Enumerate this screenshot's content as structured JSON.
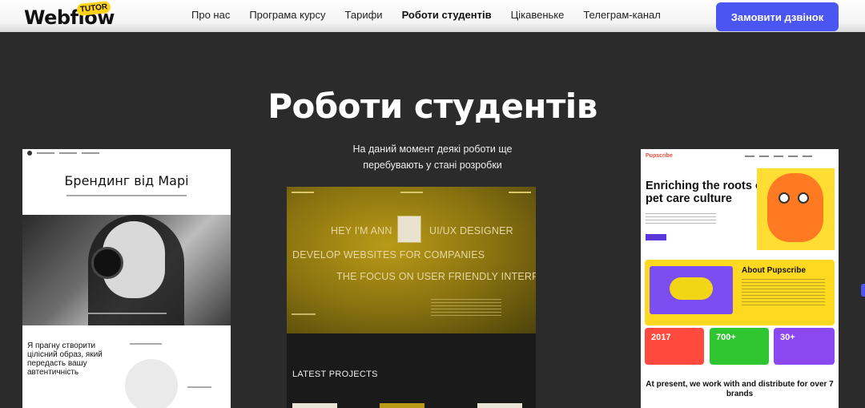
{
  "header": {
    "logo_text": "Webflow",
    "logo_badge": "TUTOR",
    "nav": [
      {
        "label": "Про нас",
        "active": false
      },
      {
        "label": "Програма курсу",
        "active": false
      },
      {
        "label": "Тарифи",
        "active": false
      },
      {
        "label": "Роботи студентів",
        "active": true
      },
      {
        "label": "Цікавеньке",
        "active": false
      },
      {
        "label": "Телеграм-канал",
        "active": false
      }
    ],
    "cta_label": "Замовити дзвінок",
    "cta_color": "#4a55f2"
  },
  "section": {
    "title": "Роботи студентів",
    "note": "На даний момент деякі роботи ще перебувають у стані розробки"
  },
  "works": {
    "left": {
      "title": "Брендинг від Марі",
      "text": "Я прагну створити цілісний образ, який передасть вашу автентичність"
    },
    "middle": {
      "line1a": "HEY I'M ANN",
      "line1b": "UI/UX DESIGNER",
      "line2": "DEVELOP WEBSITES FOR COMPANIES",
      "line3": "THE FOCUS ON USER FRIENDLY INTERFACE",
      "latest": "LATEST PROJECTS",
      "accent": "#b99a17"
    },
    "right": {
      "logo": "Pupscribe",
      "title": "Enriching the roots of pet care culture",
      "about_title": "About Pupscribe",
      "stats": [
        {
          "value": "2017",
          "color": "#ff4a3d"
        },
        {
          "value": "700+",
          "color": "#2fc531"
        },
        {
          "value": "30+",
          "color": "#8b47f0"
        }
      ],
      "bottom": "At present, we work with and distribute for over 7 brands"
    }
  }
}
